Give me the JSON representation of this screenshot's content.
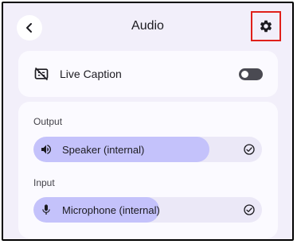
{
  "header": {
    "title": "Audio",
    "back_icon": "arrow-back-icon",
    "settings_icon": "gear-icon",
    "highlight_color": "#e0201a"
  },
  "live_caption": {
    "label": "Live Caption",
    "icon": "closed-caption-off-icon",
    "toggle_on": false
  },
  "output": {
    "section_label": "Output",
    "device_label": "Speaker (internal)",
    "icon": "volume-icon",
    "volume_level_percent": 77,
    "selected": true
  },
  "input": {
    "section_label": "Input",
    "device_label": "Microphone (internal)",
    "icon": "microphone-icon",
    "gain_level_percent": 55,
    "selected": true
  },
  "colors": {
    "background": "#f2effa",
    "card": "#fbfaff",
    "slider_track": "#ebe8f7",
    "slider_fill": "#c4c2fb"
  }
}
